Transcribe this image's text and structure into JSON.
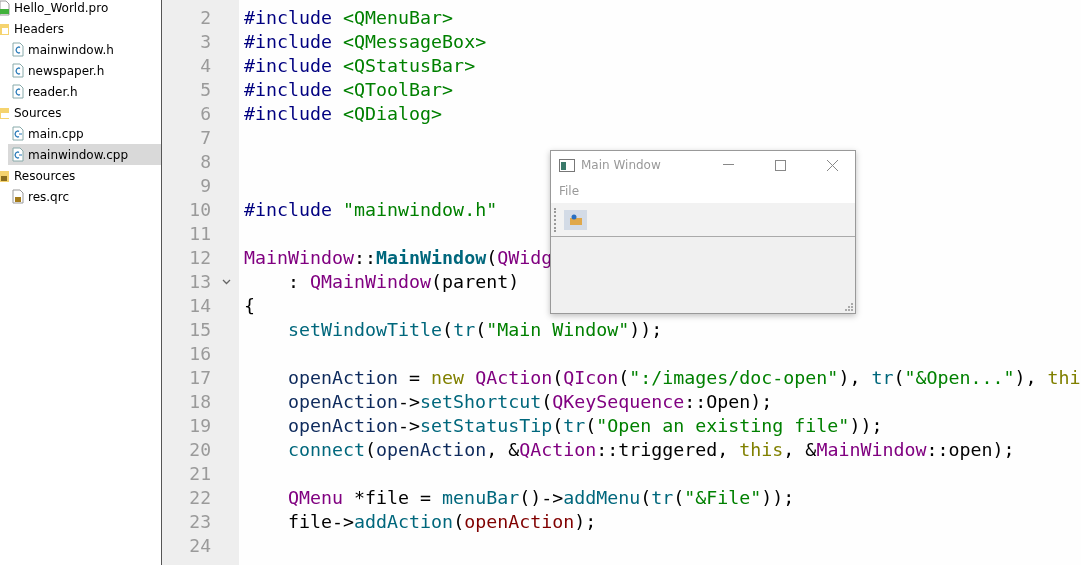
{
  "sidebar": {
    "items": [
      {
        "label": "Hello_World.pro",
        "kind": "project",
        "selected": false
      },
      {
        "label": "Headers",
        "kind": "header-folder",
        "selected": false,
        "children": [
          {
            "label": "mainwindow.h",
            "kind": "header",
            "selected": false
          },
          {
            "label": "newspaper.h",
            "kind": "header",
            "selected": false
          },
          {
            "label": "reader.h",
            "kind": "header",
            "selected": false
          }
        ]
      },
      {
        "label": "Sources",
        "kind": "source-folder",
        "selected": false,
        "children": [
          {
            "label": "main.cpp",
            "kind": "source",
            "selected": false
          },
          {
            "label": "mainwindow.cpp",
            "kind": "source",
            "selected": true
          }
        ]
      },
      {
        "label": "Resources",
        "kind": "resource-folder",
        "selected": false,
        "children": [
          {
            "label": "res.qrc",
            "kind": "resource",
            "selected": false
          }
        ]
      }
    ]
  },
  "editor": {
    "lines": [
      {
        "number": "2",
        "tokens": [
          {
            "kind": "pre",
            "text": "#include"
          },
          {
            "kind": "inc",
            "text": "<QMenuBar>"
          }
        ]
      },
      {
        "number": "3",
        "tokens": [
          {
            "kind": "pre",
            "text": "#include"
          },
          {
            "kind": "inc",
            "text": "<QMessageBox>"
          }
        ]
      },
      {
        "number": "4",
        "tokens": [
          {
            "kind": "pre",
            "text": "#include"
          },
          {
            "kind": "inc",
            "text": "<QStatusBar>"
          }
        ]
      },
      {
        "number": "5",
        "tokens": [
          {
            "kind": "pre",
            "text": "#include"
          },
          {
            "kind": "inc",
            "text": "<QToolBar>"
          }
        ]
      },
      {
        "number": "6",
        "tokens": [
          {
            "kind": "pre",
            "text": "#include"
          },
          {
            "kind": "inc",
            "text": "<QDialog>"
          }
        ]
      },
      {
        "number": "7"
      },
      {
        "number": "8"
      },
      {
        "number": "9"
      },
      {
        "number": "10",
        "tokens": [
          {
            "kind": "pre",
            "text": "#include"
          },
          {
            "kind": "inc",
            "text": "\"mainwindow.h\""
          }
        ]
      },
      {
        "number": "11"
      },
      {
        "number": "12",
        "tokens": [
          {
            "kind": "type",
            "text": "MainWindow"
          },
          {
            "kind": "plain",
            "text": "::"
          },
          {
            "kind": "bold-func",
            "text": "MainWindow"
          },
          {
            "kind": "plain",
            "text": "("
          },
          {
            "kind": "type",
            "text": "QWidg"
          }
        ]
      },
      {
        "number": "13",
        "fold_marker": true,
        "indented": true,
        "tokens": [
          {
            "kind": "plain",
            "text": ": "
          },
          {
            "kind": "type",
            "text": "QMainWindow"
          },
          {
            "kind": "plain",
            "text": "(parent)"
          }
        ]
      },
      {
        "number": "14",
        "tokens": [
          {
            "kind": "plain",
            "text": "{"
          }
        ]
      },
      {
        "number": "15",
        "indented": true,
        "tokens": [
          {
            "kind": "func",
            "text": "setWindowTitle"
          },
          {
            "kind": "plain",
            "text": "("
          },
          {
            "kind": "func",
            "text": "tr"
          },
          {
            "kind": "plain",
            "text": "("
          },
          {
            "kind": "str",
            "text": "\"Main Window\""
          },
          {
            "kind": "plain",
            "text": "));"
          }
        ]
      },
      {
        "number": "16"
      },
      {
        "number": "17",
        "indented": true,
        "tokens": [
          {
            "kind": "var",
            "text": "openAction"
          },
          {
            "kind": "plain",
            "text": " = "
          },
          {
            "kind": "keyword",
            "text": "new"
          },
          {
            "kind": "type",
            "text": "QAction",
            "space_before": true
          },
          {
            "kind": "plain",
            "text": "("
          },
          {
            "kind": "type",
            "text": "QIcon"
          },
          {
            "kind": "plain",
            "text": "("
          },
          {
            "kind": "str",
            "text": "\":/images/doc-open\""
          },
          {
            "kind": "plain",
            "text": "), "
          },
          {
            "kind": "func",
            "text": "tr"
          },
          {
            "kind": "plain",
            "text": "("
          },
          {
            "kind": "str",
            "text": "\"&Open...\""
          },
          {
            "kind": "plain",
            "text": "), "
          },
          {
            "kind": "keyword",
            "text": "thi"
          }
        ]
      },
      {
        "number": "18",
        "indented": true,
        "tokens": [
          {
            "kind": "var",
            "text": "openAction"
          },
          {
            "kind": "plain",
            "text": "->"
          },
          {
            "kind": "func",
            "text": "setShortcut"
          },
          {
            "kind": "plain",
            "text": "("
          },
          {
            "kind": "type",
            "text": "QKeySequence"
          },
          {
            "kind": "plain",
            "text": "::Open);"
          }
        ]
      },
      {
        "number": "19",
        "indented": true,
        "tokens": [
          {
            "kind": "var",
            "text": "openAction"
          },
          {
            "kind": "plain",
            "text": "->"
          },
          {
            "kind": "func",
            "text": "setStatusTip"
          },
          {
            "kind": "plain",
            "text": "("
          },
          {
            "kind": "func",
            "text": "tr"
          },
          {
            "kind": "plain",
            "text": "("
          },
          {
            "kind": "str",
            "text": "\"Open an existing file\""
          },
          {
            "kind": "plain",
            "text": "));"
          }
        ]
      },
      {
        "number": "20",
        "indented": true,
        "tokens": [
          {
            "kind": "func",
            "text": "connect"
          },
          {
            "kind": "plain",
            "text": "("
          },
          {
            "kind": "var",
            "text": "openAction"
          },
          {
            "kind": "plain",
            "text": ", &"
          },
          {
            "kind": "type",
            "text": "QAction"
          },
          {
            "kind": "plain",
            "text": "::triggered, "
          },
          {
            "kind": "keyword",
            "text": "this"
          },
          {
            "kind": "plain",
            "text": ", &"
          },
          {
            "kind": "type",
            "text": "MainWindow"
          },
          {
            "kind": "plain",
            "text": "::open);"
          }
        ]
      },
      {
        "number": "21"
      },
      {
        "number": "22",
        "indented": true,
        "tokens": [
          {
            "kind": "type",
            "text": "QMenu"
          },
          {
            "kind": "plain",
            "text": " *file = "
          },
          {
            "kind": "func",
            "text": "menuBar"
          },
          {
            "kind": "plain",
            "text": "()->"
          },
          {
            "kind": "func",
            "text": "addMenu"
          },
          {
            "kind": "plain",
            "text": "("
          },
          {
            "kind": "func",
            "text": "tr"
          },
          {
            "kind": "plain",
            "text": "("
          },
          {
            "kind": "str",
            "text": "\"&File\""
          },
          {
            "kind": "plain",
            "text": "));"
          }
        ]
      },
      {
        "number": "23",
        "indented": true,
        "tokens": [
          {
            "kind": "plain",
            "text": "file->"
          },
          {
            "kind": "func",
            "text": "addAction"
          },
          {
            "kind": "plain",
            "text": "("
          },
          {
            "kind": "member",
            "text": "openAction"
          },
          {
            "kind": "plain",
            "text": ");"
          }
        ]
      },
      {
        "number": "24"
      }
    ]
  },
  "preview_window": {
    "title": "Main Window",
    "menu": [
      "File"
    ]
  }
}
